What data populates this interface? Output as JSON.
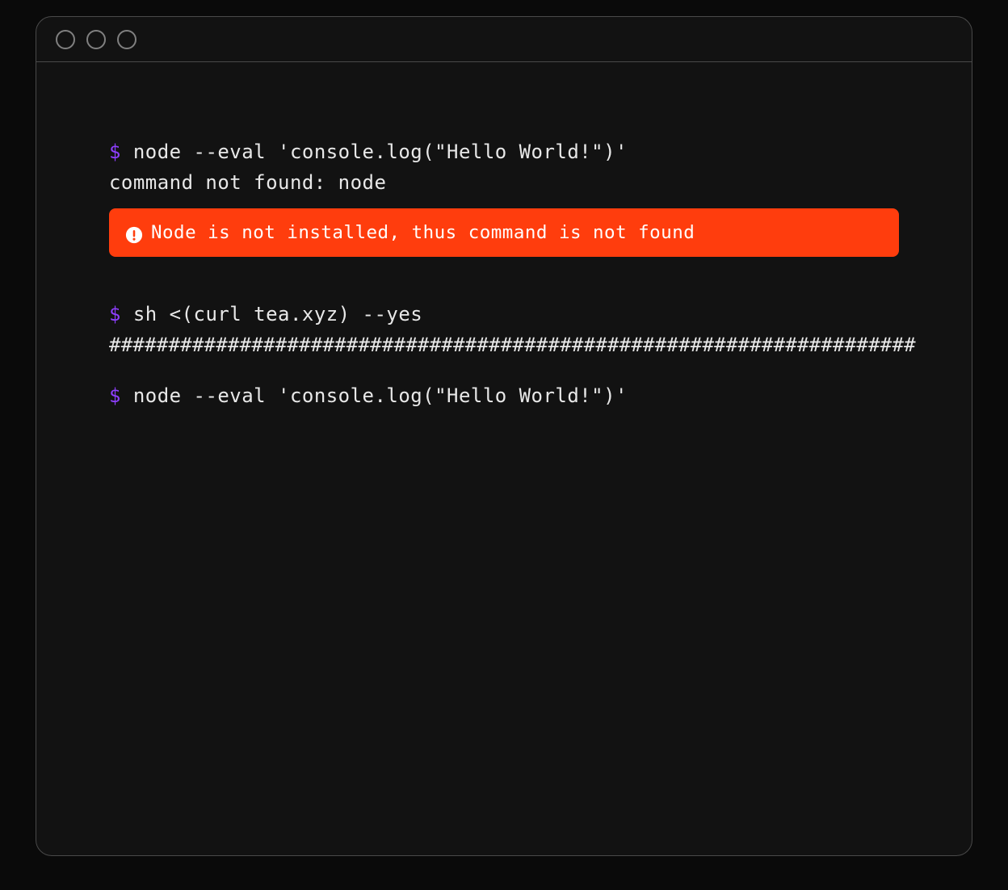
{
  "terminal": {
    "prompt": "$",
    "lines": {
      "cmd1": "node --eval 'console.log(\"Hello World!\")'",
      "out1": "command not found: node",
      "alert": "Node is not installed, thus command is not found",
      "cmd2": "sh <(curl tea.xyz) --yes",
      "out2": "####################################################################",
      "cmd3": "node --eval 'console.log(\"Hello World!\")'"
    }
  },
  "colors": {
    "prompt": "#8f3fff",
    "alert_bg": "#ff3d0d",
    "text": "#e8e8e8",
    "bg": "#121212",
    "border": "#4a4a4a"
  }
}
